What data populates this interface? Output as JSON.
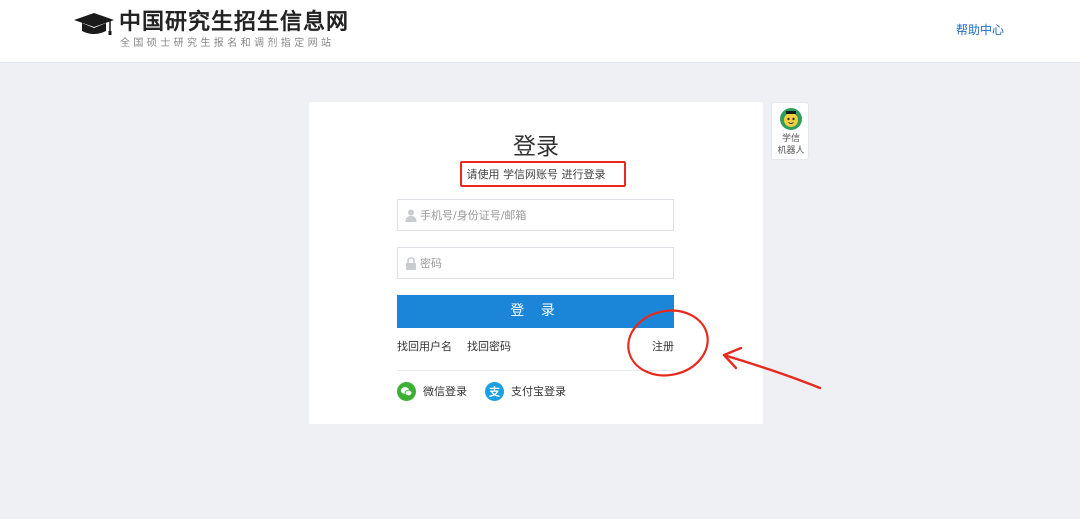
{
  "header": {
    "site_title": "中国研究生招生信息网",
    "site_subtitle": "全国硕士研究生报名和调剂指定网站",
    "help_link": "帮助中心",
    "logo_icon": "graduation-cap-icon"
  },
  "login": {
    "title": "登录",
    "subtitle": "请使用 学信网账号 进行登录",
    "username_placeholder": "手机号/身份证号/邮箱",
    "password_placeholder": "密码",
    "username_icon": "user-icon",
    "password_icon": "lock-icon",
    "submit_label": "登 录",
    "find_username": "找回用户名",
    "find_password": "找回密码",
    "register": "注册",
    "wechat_login": "微信登录",
    "alipay_login": "支付宝登录",
    "alipay_glyph": "支"
  },
  "robot": {
    "label_line1": "学信",
    "label_line2": "机器人"
  },
  "colors": {
    "primary": "#1b86d8",
    "link": "#1e6fc4",
    "annotation": "#e62a1e",
    "wechat": "#3cb034",
    "alipay": "#1aa0e2",
    "background": "#eef0f3"
  }
}
